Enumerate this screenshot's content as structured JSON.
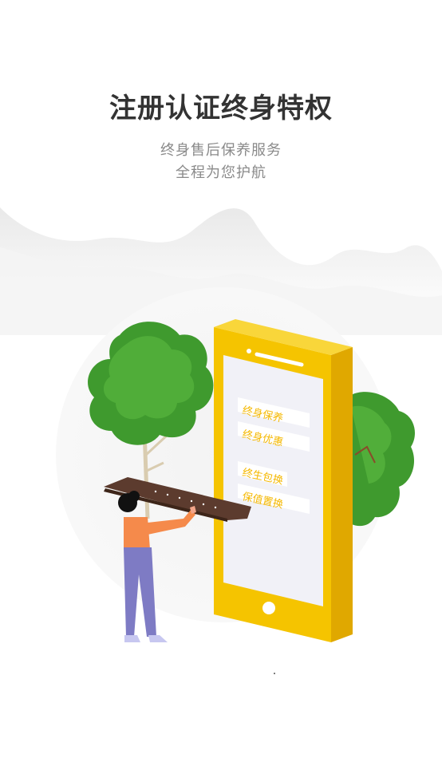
{
  "header": {
    "title": "注册认证终身特权",
    "subtitle_line1": "终身售后保养服务",
    "subtitle_line2": "全程为您护航"
  },
  "phone_screen": {
    "features": [
      "终身保养",
      "终身优惠",
      "终生包换",
      "保值置换"
    ]
  },
  "colors": {
    "accent": "#f5c400",
    "title_text": "#333333",
    "subtitle_text": "#8a8a8a",
    "tree_green": "#3f9a2e",
    "person_shirt": "#f58a4b",
    "person_pants": "#7e7bc4"
  }
}
